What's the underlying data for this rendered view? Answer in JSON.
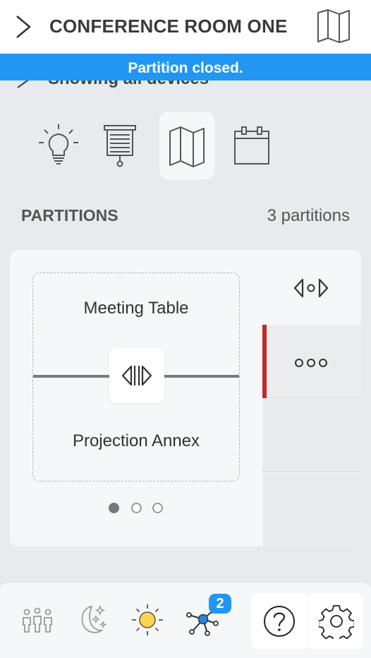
{
  "header": {
    "title": "CONFERENCE ROOM ONE",
    "back_icon": "chevron-right-icon",
    "map_icon": "map-icon"
  },
  "banner": {
    "message": "Partition closed."
  },
  "subnav": {
    "label": "Showing all devices"
  },
  "tabs": [
    {
      "name": "lighting",
      "icon": "lightbulb-icon",
      "active": false
    },
    {
      "name": "shades",
      "icon": "projector-screen-icon",
      "active": false
    },
    {
      "name": "partitions",
      "icon": "map-icon",
      "active": true
    },
    {
      "name": "schedule",
      "icon": "calendar-icon",
      "active": false
    }
  ],
  "partitions": {
    "section_label": "PARTITIONS",
    "count_label": "3 partitions",
    "current": {
      "room_a": "Meeting Table",
      "room_b": "Projection Annex",
      "state": "closed"
    },
    "pager": {
      "pages": 3,
      "current": 1
    },
    "side_rows": [
      "open-all",
      "more",
      "",
      ""
    ]
  },
  "bottom_bar": {
    "items": [
      {
        "name": "occupancy",
        "icon": "people-icon"
      },
      {
        "name": "night-mode",
        "icon": "moon-stars-icon"
      },
      {
        "name": "daylight",
        "icon": "sun-icon"
      },
      {
        "name": "network",
        "icon": "network-hub-icon",
        "badge": "2"
      },
      {
        "name": "help",
        "icon": "help-icon"
      },
      {
        "name": "settings",
        "icon": "gear-icon"
      }
    ]
  },
  "colors": {
    "accent_blue": "#2196f3",
    "alert_red": "#c62828",
    "sun_yellow": "#ffd54f",
    "hub_blue": "#1e88e5"
  }
}
